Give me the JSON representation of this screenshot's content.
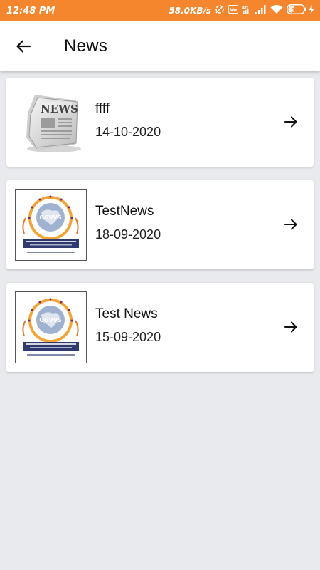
{
  "status_bar": {
    "time": "12:48 PM",
    "network_speed": "58.0KB/s",
    "battery": "36",
    "icons": [
      "data-saver-icon",
      "volte-icon",
      "4g-icon",
      "signal-icon",
      "wifi-icon",
      "battery-icon",
      "charging-icon"
    ]
  },
  "app_bar": {
    "title": "News",
    "back_icon": "arrow-left-icon"
  },
  "colors": {
    "status_bar": "#f5862e",
    "background": "#e8eaed",
    "card": "#ffffff"
  },
  "news": [
    {
      "title": "ffff",
      "date": "14-10-2020",
      "thumbnail": "newspaper-icon"
    },
    {
      "title": "TestNews",
      "date": "18-09-2020",
      "thumbnail": "ggvvs-logo"
    },
    {
      "title": "Test News",
      "date": "15-09-2020",
      "thumbnail": "ggvvs-logo"
    }
  ]
}
